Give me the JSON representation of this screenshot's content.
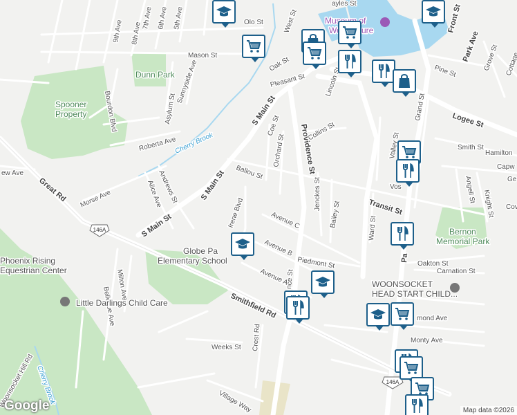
{
  "map": {
    "attribution": "Map data ©2026",
    "logo": "Google",
    "colors": {
      "land": "#f2f2f0",
      "park": "#c9e7c4",
      "water": "#a8d8f0",
      "road": "#ffffff",
      "major_road": "#ffffff",
      "marker_border": "#1d5f8a"
    }
  },
  "streets": {
    "olo": "Olo St",
    "west": "West St",
    "mason": "Mason St",
    "oak": "Oak St",
    "pleasant": "Pleasant St",
    "s_main_top": "S Main St",
    "s_main_mid": "S Main St",
    "s_main_low": "S Main St",
    "coe": "Coe St",
    "orchard": "Orchard St",
    "collins": "Collins St",
    "providence": "Providence St",
    "lincoln": "Lincoln St",
    "ballou": "Ballou St",
    "jenckes": "Jenckes St",
    "bailey": "Bailey St",
    "transit": "Transit St",
    "avenue_c": "Avenue C",
    "avenue_b": "Avenue B",
    "avenue_a": "Avenue A",
    "piedmont": "Piedmont St",
    "irene": "Irene Blvd",
    "alice": "Alice Ave",
    "andrews": "Andrews St",
    "roberta": "Roberta Ave",
    "morse": "Morse Ave",
    "great": "Great Rd",
    "ew": "ew Ave",
    "bourdon": "Bourdon Blvd",
    "asylum": "Asylum St",
    "sunnyside": "Sunnyside Ave",
    "ave9": "9th Ave",
    "ave8": "8th Ave",
    "ave7": "7th Ave",
    "ave6": "6th Ave",
    "ave5": "5th Ave",
    "milton": "Milton Ave",
    "bellevue": "Bellevue Ave",
    "woonsocket_hill": "Woonsocket Hill Rd",
    "smithfield": "Smithfield Rd",
    "weeks": "Weeks St",
    "crest": "Crest Rd",
    "village": "Village Way",
    "logee": "Logee St",
    "smith": "Smith St",
    "hamilton": "Hamilton",
    "capwell": "Capw",
    "angell": "Angell St",
    "knight": "Knight St",
    "grand": "Grand St",
    "valley": "Valley St",
    "ward": "Ward St",
    "oakton": "Oakton St",
    "carnation": "Carnation St",
    "monty": "Monty Ave",
    "richmond": "mond Ave",
    "pine": "Pine St",
    "grove": "Grove St",
    "cottage": "Cottage",
    "park": "Park Ave",
    "front": "Front St",
    "vose": "Vos",
    "route_146a": "146A",
    "ge": "Ge",
    "cov": "Cov",
    "ayles": "ayles St",
    "ce_st": "nce St",
    "pa": "Pa"
  },
  "places": {
    "dunn_park": "Dunn Park",
    "spooner": [
      "Spooner",
      "Property"
    ],
    "museum": [
      "Museum of",
      "Work",
      "lture"
    ],
    "bernon": [
      "Bernon",
      "Memorial Park"
    ],
    "globe_school": [
      "Globe Pa",
      "Elementary School"
    ],
    "phoenix": [
      "Phoenix Rising",
      "Equestrian Center"
    ],
    "little_darlings": "Little Darlings Child Care",
    "head_start": [
      "WOONSOCKET",
      "HEAD START CHILD..."
    ],
    "cherry_brook_1": "Cherry Brook",
    "cherry_brook_2": "Cherry Brook"
  },
  "markers": [
    {
      "icon": "school-icon"
    },
    {
      "icon": "shopping-cart-icon"
    },
    {
      "icon": "shopping-bag-icon"
    },
    {
      "icon": "shopping-cart-icon"
    },
    {
      "icon": "restaurant-icon"
    },
    {
      "icon": "restaurant-icon"
    },
    {
      "icon": "shopping-bag-icon"
    },
    {
      "icon": "shopping-cart-icon"
    },
    {
      "icon": "school-icon"
    },
    {
      "icon": "shopping-cart-icon"
    },
    {
      "icon": "restaurant-icon"
    },
    {
      "icon": "restaurant-icon"
    },
    {
      "icon": "school-icon"
    },
    {
      "icon": "school-icon"
    },
    {
      "icon": "restaurant-icon"
    },
    {
      "icon": "restaurant-icon"
    },
    {
      "icon": "school-icon"
    },
    {
      "icon": "shopping-cart-icon"
    },
    {
      "icon": "restaurant-icon"
    },
    {
      "icon": "shopping-cart-icon"
    },
    {
      "icon": "shopping-cart-icon"
    },
    {
      "icon": "restaurant-icon"
    }
  ]
}
